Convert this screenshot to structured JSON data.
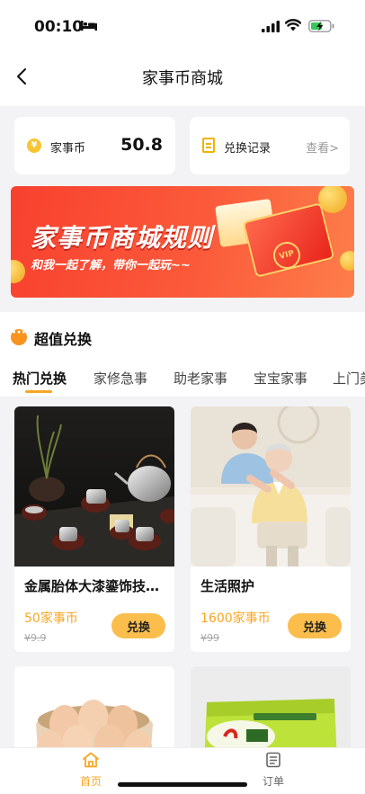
{
  "status_bar": {
    "time": "00:10"
  },
  "nav": {
    "title": "家事币商城"
  },
  "coin_card": {
    "label": "家事币",
    "value": "50.8",
    "icon": "¥"
  },
  "record_card": {
    "label": "兑换记录",
    "link": "查看>"
  },
  "banner": {
    "title": "家事币商城规则",
    "subtitle": "和我一起了解，带你一起玩~~",
    "badge": "VIP"
  },
  "section": {
    "title": "超值兑换"
  },
  "tabs": [
    {
      "label": "热门兑换"
    },
    {
      "label": "家修急事"
    },
    {
      "label": "助老家事"
    },
    {
      "label": "宝宝家事"
    },
    {
      "label": "上门美"
    }
  ],
  "products": [
    {
      "name": "金属胎体大漆鎏饰技…",
      "price": "50家事币",
      "original_price": "¥9.9",
      "button": "兑换"
    },
    {
      "name": "生活照护",
      "price": "1600家事币",
      "original_price": "¥99",
      "button": "兑换"
    }
  ],
  "tabbar": {
    "home": "首页",
    "orders": "订单",
    "active_color": "#f7a724",
    "inactive_color": "#666666"
  },
  "colors": {
    "accent": "#f7a724",
    "banner_red": "#f8412f",
    "button_yellow": "#fbbd4c"
  }
}
